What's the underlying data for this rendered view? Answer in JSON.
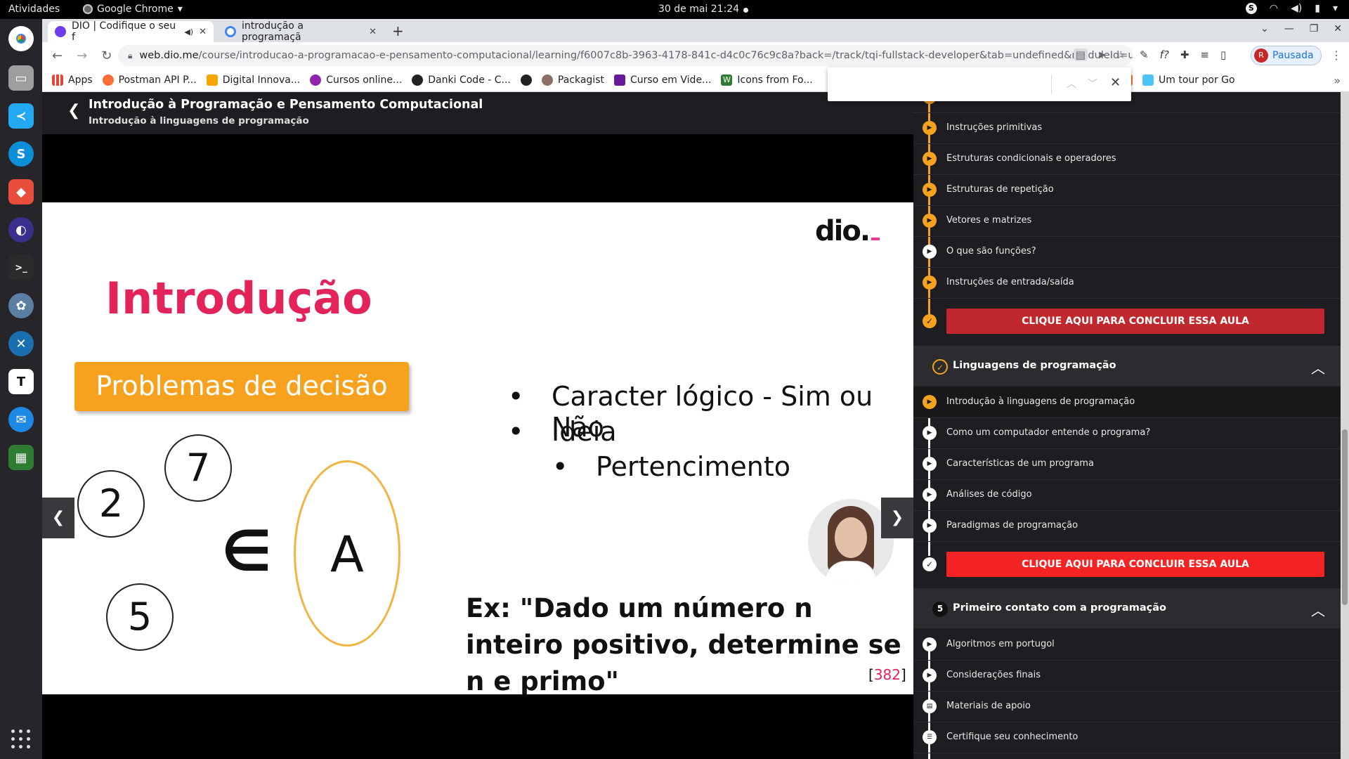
{
  "topbar": {
    "activities": "Atividades",
    "app": "Google Chrome",
    "clock": "30 de mai  21:24"
  },
  "browser": {
    "tabs": [
      {
        "title": "DIO | Codifique o seu f",
        "active": true
      },
      {
        "title": "introdução a programaçã",
        "active": false
      }
    ],
    "url_host": "web.dio.me",
    "url_path": "/course/introducao-a-programacao-e-pensamento-computacional/learning/f6007c8b-3963-4178-841c-d4c0c76c9c8a?back=/track/tqi-fullstack-developer&tab=undefined&moduleId=undefined",
    "profile_label": "Pausada",
    "profile_initial": "R",
    "bookmarks": [
      "Apps",
      "Postman API P...",
      "Digital Innova...",
      "Cursos online...",
      "Danki Code - C...",
      "",
      "Packagist",
      "Curso em Vide...",
      "Icons from Fo...",
      "...",
      "",
      "Um tour por Go"
    ]
  },
  "course": {
    "title": "Introdução à Programação e Pensamento Computacional",
    "lesson": "Introdução à linguagens de programação"
  },
  "slide": {
    "logo": "dio",
    "title": "Introdução",
    "box": "Problemas de decisão",
    "circles": [
      "7",
      "2",
      "5"
    ],
    "element_symbol": "∈",
    "set_label": "A",
    "bullets": [
      "Caracter lógico - Sim ou Não",
      "Ideia",
      "Pertencimento"
    ],
    "example": "Ex: \"Dado um número n inteiro positivo, determine se n e primo\"",
    "page_number": "382"
  },
  "sidebar": {
    "module1_items": [
      "Instruções primitivas",
      "Estruturas condicionais e operadores",
      "Estruturas de repetição",
      "Vetores e matrizes",
      "O que são funções?",
      "Instruções de entrada/saída"
    ],
    "complete_button": "CLIQUE AQUI PARA CONCLUIR ESSA AULA",
    "module2_title": "Linguagens de programação",
    "module2_items": [
      "Introdução à linguagens de programação",
      "Como um computador entende o programa?",
      "Características de um programa",
      "Análises de código",
      "Paradigmas de programação"
    ],
    "module3_number": "5",
    "module3_title": "Primeiro contato com a programação",
    "module3_items": [
      "Algoritmos em portugol",
      "Considerações finais",
      "Materiais de apoio",
      "Certifique seu conhecimento"
    ]
  },
  "colors": {
    "accent": "#f6a21e",
    "brand_pink": "#e3245a",
    "complete_red": "#f42424"
  }
}
